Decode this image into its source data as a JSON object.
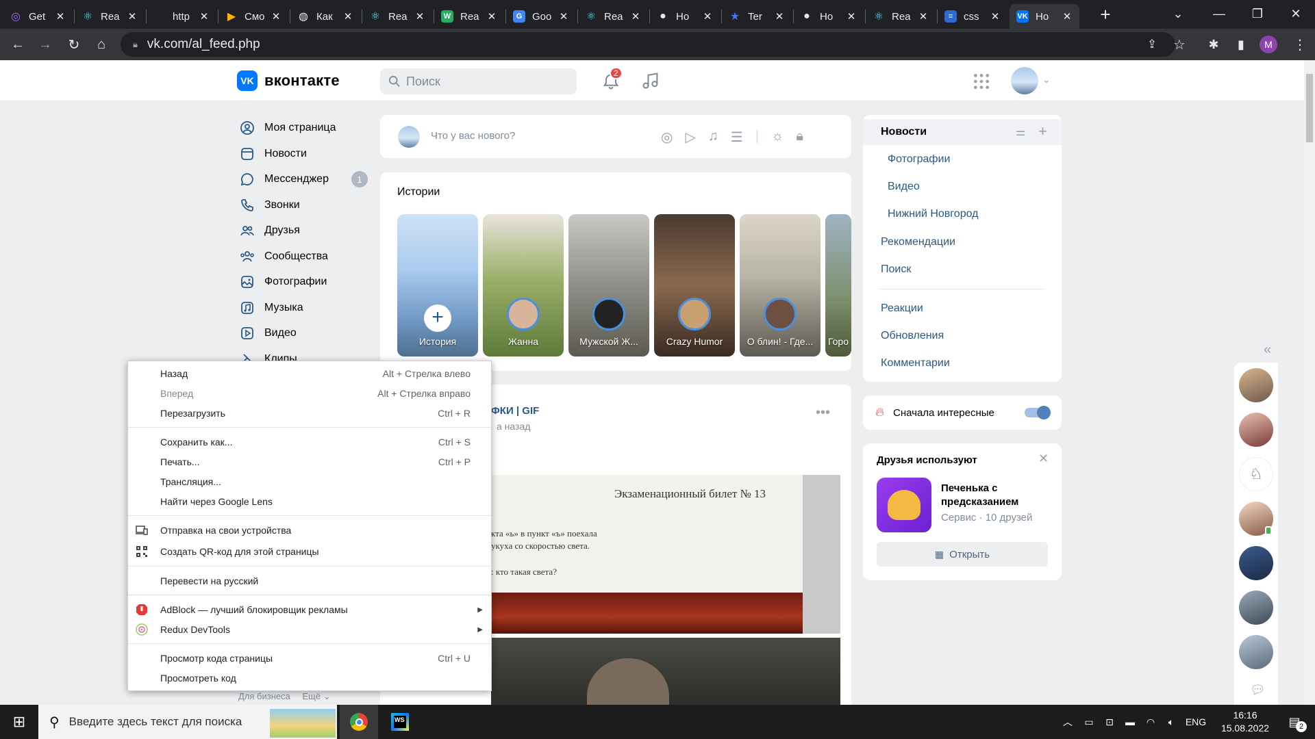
{
  "browser": {
    "tabs": [
      {
        "title": "Get",
        "icon": "spiral-icon",
        "color": "#9c6bff"
      },
      {
        "title": "Rea",
        "icon": "react-icon",
        "color": "#61dafb"
      },
      {
        "title": "http",
        "icon": "blank-page-icon",
        "color": "#35363a"
      },
      {
        "title": "Смо",
        "icon": "play-icon",
        "color": "#ffb300"
      },
      {
        "title": "Как",
        "icon": "globe-icon",
        "color": "#e8eaed"
      },
      {
        "title": "Rea",
        "icon": "react-icon",
        "color": "#61dafb"
      },
      {
        "title": "Rea",
        "icon": "w-icon",
        "color": "#27ae60"
      },
      {
        "title": "Goo",
        "icon": "translate-icon",
        "color": "#4285f4"
      },
      {
        "title": "Rea",
        "icon": "react-icon",
        "color": "#61dafb"
      },
      {
        "title": "Ho",
        "icon": "github-icon",
        "color": "#e8eaed"
      },
      {
        "title": "Ter",
        "icon": "star-icon",
        "color": "#3d7cf4"
      },
      {
        "title": "Ho",
        "icon": "github-icon",
        "color": "#e8eaed"
      },
      {
        "title": "Rea",
        "icon": "react-icon",
        "color": "#61dafb"
      },
      {
        "title": "css",
        "icon": "stack-icon",
        "color": "#2d6bcf"
      },
      {
        "title": "Ho",
        "icon": "vk-icon",
        "color": "#0077ff"
      }
    ],
    "url": "vk.com/al_feed.php",
    "profile_initial": "M"
  },
  "vk": {
    "logo_text": "вконтакте",
    "logo_mark": "VK",
    "search_placeholder": "Поиск",
    "notifications_count": "2",
    "left_menu": [
      {
        "label": "Моя страница",
        "icon": "user-circle-icon"
      },
      {
        "label": "Новости",
        "icon": "news-icon"
      },
      {
        "label": "Мессенджер",
        "icon": "message-icon",
        "badge": "1"
      },
      {
        "label": "Звонки",
        "icon": "phone-icon"
      },
      {
        "label": "Друзья",
        "icon": "friends-icon"
      },
      {
        "label": "Сообщества",
        "icon": "communities-icon"
      },
      {
        "label": "Фотографии",
        "icon": "photo-icon"
      },
      {
        "label": "Музыка",
        "icon": "music-icon"
      },
      {
        "label": "Видео",
        "icon": "video-icon"
      },
      {
        "label": "Клипы",
        "icon": "clips-icon"
      }
    ],
    "footer_links": {
      "business": "Для бизнеса",
      "more": "Ещё"
    },
    "composer_placeholder": "Что у вас нового?",
    "stories_title": "Истории",
    "stories": [
      {
        "label": "История"
      },
      {
        "label": "Жанна"
      },
      {
        "label": "Мужской Ж..."
      },
      {
        "label": "Crazy Humor"
      },
      {
        "label": "О блин! - Где..."
      },
      {
        "label": "Горо"
      }
    ],
    "post": {
      "author": "ФКИ | GIF",
      "time": "а назад",
      "ticket_title": "Экзаменационный билет № 13",
      "ticket_line1": "кта «ь» в пункт «ъ» поехала",
      "ticket_line2": "укуха со скоростью света.",
      "ticket_line3": ": кто такая света?"
    },
    "right_nav": {
      "active": "Новости",
      "sub": [
        "Фотографии",
        "Видео",
        "Нижний Новгород"
      ],
      "links": [
        "Рекомендации",
        "Поиск"
      ],
      "links2": [
        "Реакции",
        "Обновления",
        "Комментарии"
      ]
    },
    "interesting_toggle": {
      "label": "Сначала интересные",
      "on": true
    },
    "friends_use": {
      "title": "Друзья используют",
      "app_name": "Печенька с предсказанием",
      "app_meta": "Сервис · 10 друзей",
      "open_button": "Открыть"
    }
  },
  "context_menu": {
    "groups": [
      [
        {
          "label": "Назад",
          "shortcut": "Alt + Стрелка влево"
        },
        {
          "label": "Вперед",
          "shortcut": "Alt + Стрелка вправо",
          "disabled": true
        },
        {
          "label": "Перезагрузить",
          "shortcut": "Ctrl + R"
        }
      ],
      [
        {
          "label": "Сохранить как...",
          "shortcut": "Ctrl + S"
        },
        {
          "label": "Печать...",
          "shortcut": "Ctrl + P"
        },
        {
          "label": "Трансляция..."
        },
        {
          "label": "Найти через Google Lens"
        }
      ],
      [
        {
          "label": "Отправка на свои устройства",
          "icon": "devices-icon"
        },
        {
          "label": "Создать QR-код для этой страницы",
          "icon": "qr-code-icon"
        }
      ],
      [
        {
          "label": "Перевести на русский"
        }
      ],
      [
        {
          "label": "AdBlock — лучший блокировщик рекламы",
          "icon": "adblock-icon",
          "submenu": true
        },
        {
          "label": "Redux DevTools",
          "icon": "redux-icon",
          "submenu": true
        }
      ],
      [
        {
          "label": "Просмотр кода страницы",
          "shortcut": "Ctrl + U"
        },
        {
          "label": "Просмотреть код"
        }
      ]
    ]
  },
  "taskbar": {
    "search_placeholder": "Введите здесь текст для поиска",
    "language": "ENG",
    "time": "16:16",
    "date": "15.08.2022",
    "notifications": "2"
  }
}
